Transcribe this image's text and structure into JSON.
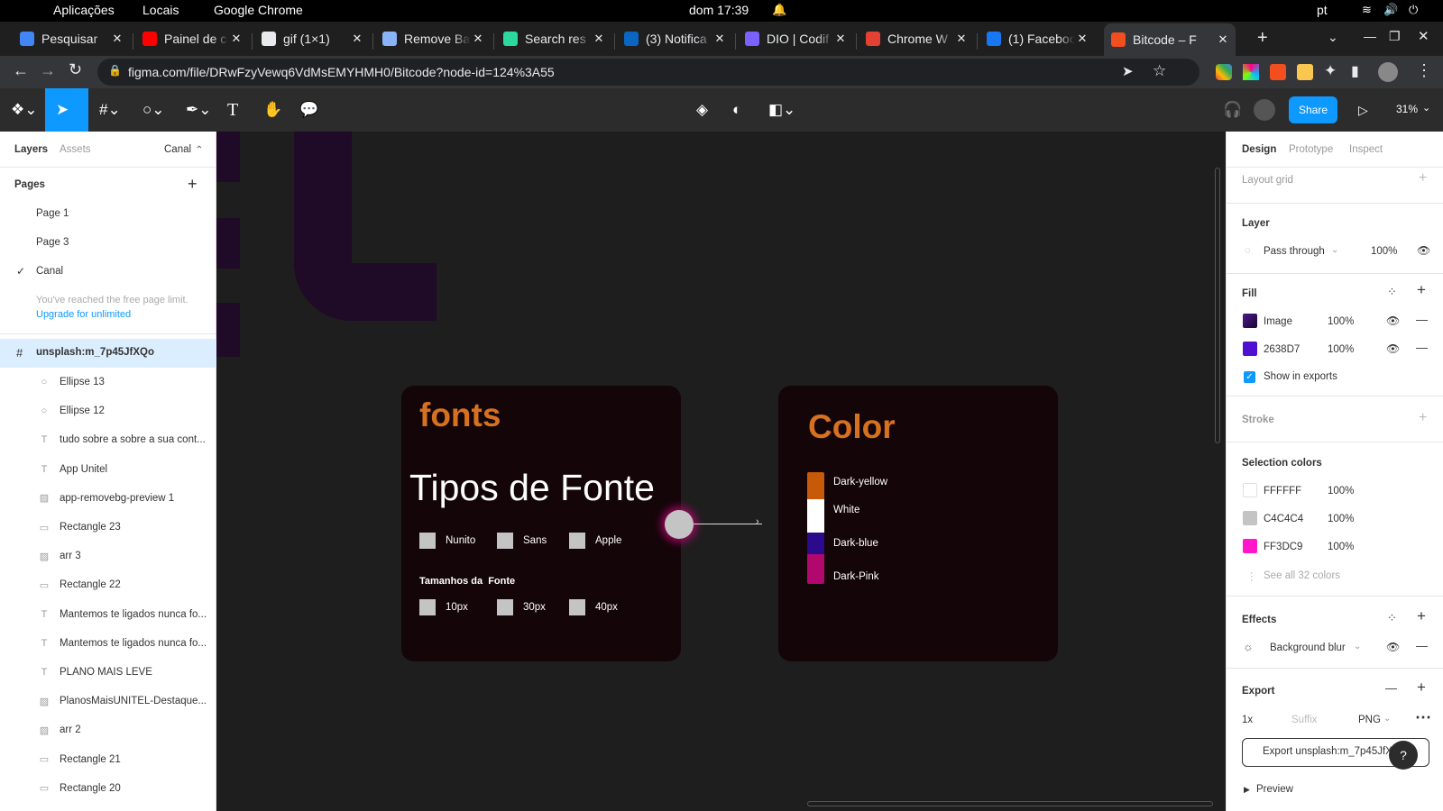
{
  "os_bar": {
    "apple": "",
    "menu1": "Aplicações",
    "menu2": "Locais",
    "app": "Google Chrome",
    "clock": "dom 17:39",
    "lang": "pt"
  },
  "tabs": [
    {
      "label": "Pesquisar",
      "color": "#4285f4"
    },
    {
      "label": "Painel de c",
      "color": "#ff0000"
    },
    {
      "label": "gif (1×1)",
      "color": "#e8eaed"
    },
    {
      "label": "Remove Ba",
      "color": "#8ab4f8"
    },
    {
      "label": "Search res",
      "color": "#2bd99f"
    },
    {
      "label": "(3) Notifica",
      "color": "#0a66c2"
    },
    {
      "label": "DIO | Codif",
      "color": "#7b61ff"
    },
    {
      "label": "Chrome W",
      "color": "#e34133"
    },
    {
      "label": "(1) Faceboo",
      "color": "#1877f2"
    },
    {
      "label": "Bitcode – F",
      "color": "#f24e1e"
    }
  ],
  "address": {
    "url": "figma.com/file/DRwFzyVewq6VdMsEMYHMH0/Bitcode?node-id=124%3A55"
  },
  "figma_toolbar": {
    "share": "Share",
    "zoom": "31%"
  },
  "left_panel": {
    "tab_layers": "Layers",
    "tab_assets": "Assets",
    "page_selector": "Canal",
    "pages_title": "Pages",
    "pages": [
      "Page 1",
      "Page 3",
      "Canal"
    ],
    "free_limit": "You've reached the free page limit.",
    "upgrade": "Upgrade for unlimited",
    "frame": "unsplash:m_7p45JfXQo",
    "layers": [
      {
        "name": "Ellipse 13",
        "icon": "ellipse"
      },
      {
        "name": "Ellipse 12",
        "icon": "ellipse"
      },
      {
        "name": "tudo sobre a sobre a sua cont...",
        "icon": "text"
      },
      {
        "name": "App Unitel",
        "icon": "text"
      },
      {
        "name": "app-removebg-preview 1",
        "icon": "image"
      },
      {
        "name": "Rectangle 23",
        "icon": "rect"
      },
      {
        "name": "arr 3",
        "icon": "image"
      },
      {
        "name": "Rectangle 22",
        "icon": "rect"
      },
      {
        "name": "Mantemos te ligados nunca fo...",
        "icon": "text"
      },
      {
        "name": "Mantemos te ligados nunca fo...",
        "icon": "text"
      },
      {
        "name": "PLANO MAIS LEVE",
        "icon": "text"
      },
      {
        "name": "PlanosMaisUNITEL-Destaque...",
        "icon": "image"
      },
      {
        "name": "arr 2",
        "icon": "image"
      },
      {
        "name": "Rectangle 21",
        "icon": "rect"
      },
      {
        "name": "Rectangle 20",
        "icon": "rect"
      }
    ]
  },
  "canvas": {
    "fonts_card": {
      "title": "fonts",
      "heading": "Tipos de Fonte",
      "families": [
        "Nunito",
        "Sans",
        "Apple"
      ],
      "sizes_title": "Tamanhos da  Fonte",
      "sizes": [
        "10px",
        "30px",
        "40px"
      ]
    },
    "color_card": {
      "title": "Color",
      "colors": [
        {
          "name": "Dark-yellow",
          "hex": "#c75a08"
        },
        {
          "name": "White",
          "hex": "#ffffff"
        },
        {
          "name": "Dark-blue",
          "hex": "#2b0a8c"
        },
        {
          "name": "Dark-Pink",
          "hex": "#b1086d"
        }
      ]
    },
    "accent": "#d6711f"
  },
  "right_panel": {
    "tabs": [
      "Design",
      "Prototype",
      "Inspect"
    ],
    "layout_grid": "Layout grid",
    "layer_title": "Layer",
    "blend": "Pass through",
    "layer_opacity": "100%",
    "fill_title": "Fill",
    "fills": [
      {
        "label": "Image",
        "opacity": "100%",
        "color": "#4b1a8c"
      },
      {
        "label": "2638D7",
        "opacity": "100%",
        "color": "#2638d7"
      }
    ],
    "show_exports": "Show in exports",
    "stroke_title": "Stroke",
    "selection_title": "Selection colors",
    "selection_colors": [
      {
        "hex": "FFFFFF",
        "opacity": "100%",
        "color": "#ffffff"
      },
      {
        "hex": "C4C4C4",
        "opacity": "100%",
        "color": "#c4c4c4"
      },
      {
        "hex": "FF3DC9",
        "opacity": "100%",
        "color": "#ff3dc9"
      }
    ],
    "see_all": "See all 32 colors",
    "effects_title": "Effects",
    "effect": "Background blur",
    "export_title": "Export",
    "export_scale": "1x",
    "export_suffix": "Suffix",
    "export_format": "PNG",
    "export_button": "Export unsplash:m_7p45JfX",
    "preview": "Preview",
    "help": "?"
  }
}
